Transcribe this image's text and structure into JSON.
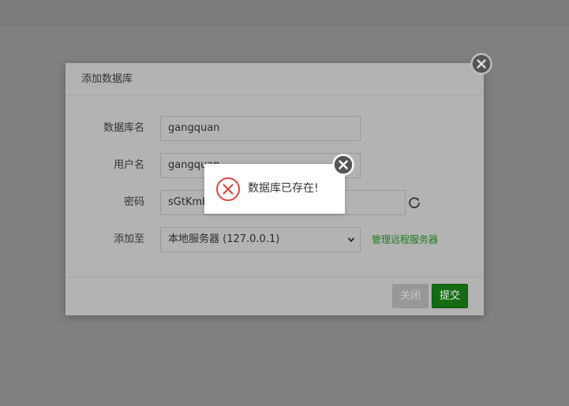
{
  "dialog": {
    "title": "添加数据库",
    "fields": {
      "db_name": {
        "label": "数据库名",
        "value": "gangquan"
      },
      "username": {
        "label": "用户名",
        "value": "gangquan"
      },
      "password": {
        "label": "密码",
        "value": "sGtKmb"
      },
      "target": {
        "label": "添加至",
        "value": "本地服务器 (127.0.0.1)"
      }
    },
    "manage_remote_label": "管理远程服务器",
    "buttons": {
      "close_label": "关闭",
      "submit_label": "提交"
    }
  },
  "toast": {
    "message": "数据库已存在!",
    "icon": "error-x-circle-icon"
  },
  "icons": {
    "dialog_close": "close-circle-icon",
    "refresh": "refresh-icon",
    "select": "chevron-down-icon"
  },
  "colors": {
    "overlay": "#808080",
    "dialog_bg": "#b3b3b3",
    "link_green": "#1e7a1e",
    "submit_green": "#146b14",
    "error_red": "#e0453a"
  }
}
